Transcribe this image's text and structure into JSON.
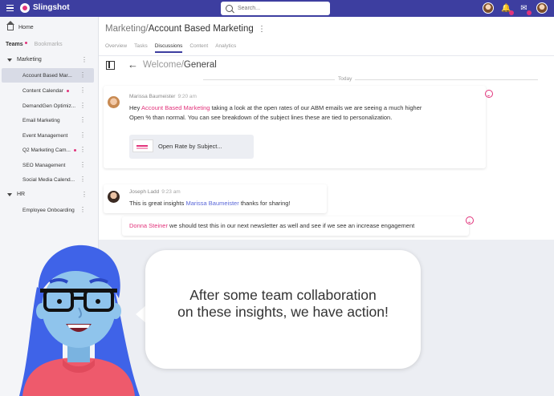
{
  "app": {
    "brand": "Slingshot"
  },
  "search": {
    "placeholder": "Search..."
  },
  "topbar": {
    "icons": [
      "avatar",
      "bell-icon",
      "inbox-icon",
      "user-avatar"
    ]
  },
  "sidebar": {
    "home_label": "Home",
    "tabs": [
      {
        "label": "Teams",
        "active": true
      },
      {
        "label": "Bookmarks",
        "active": false
      }
    ],
    "groups": [
      {
        "label": "Marketing",
        "items": [
          {
            "label": "Account Based Mar...",
            "active": true,
            "dot": false
          },
          {
            "label": "Content Calendar",
            "active": false,
            "dot": true
          },
          {
            "label": "DemandGen Optimiz...",
            "active": false,
            "dot": false
          },
          {
            "label": "Email Marketing",
            "active": false,
            "dot": false
          },
          {
            "label": "Event Management",
            "active": false,
            "dot": false
          },
          {
            "label": "Q2 Marketing Cam...",
            "active": false,
            "dot": true
          },
          {
            "label": "SEO Management",
            "active": false,
            "dot": false
          },
          {
            "label": "Social Media Calend...",
            "active": false,
            "dot": false
          }
        ]
      },
      {
        "label": "HR",
        "items": [
          {
            "label": "Employee Onboarding",
            "active": false,
            "dot": false
          }
        ]
      }
    ]
  },
  "header": {
    "crumb_parent": "Marketing",
    "crumb_sep": "/",
    "crumb_current": "Account Based Marketing",
    "tabs": [
      {
        "label": "Overview",
        "active": false
      },
      {
        "label": "Tasks",
        "active": false
      },
      {
        "label": "Discussions",
        "active": true
      },
      {
        "label": "Content",
        "active": false
      },
      {
        "label": "Analytics",
        "active": false
      }
    ]
  },
  "channel": {
    "parent": "Welcome",
    "sep": "/",
    "name": "General"
  },
  "divider": {
    "label": "Today"
  },
  "messages": {
    "m1": {
      "author": "Marissa Baumeister",
      "time": "9:20 am",
      "pre": "Hey ",
      "mention": "Account Based Marketing",
      "line1_rest": " taking a look at the open rates of our ABM emails we are seeing a much higher",
      "line2": "Open % than normal. You can see breakdown of the subject lines these are tied to personalization.",
      "attachment": "Open Rate by Subject..."
    },
    "m2": {
      "author": "Joseph Ladd",
      "time": "9:23 am",
      "pre": "This is great insights ",
      "mention": "Marissa Baumeister",
      "post": " thanks for sharing!"
    },
    "m3": {
      "mention": "Donna Steiner",
      "post": " we should test this in our next newsletter as well and see if we see an increase engagement"
    }
  },
  "callout": {
    "line1": "After some team collaboration",
    "line2": "on these insights, we have action!"
  },
  "colors": {
    "topbar": "#3d3ea0",
    "accent": "#e2337b",
    "mention_blue": "#5a67d8",
    "character_hair": "#3f63e8",
    "character_skin": "#8fc4ec",
    "character_shirt": "#ee5a6c"
  }
}
